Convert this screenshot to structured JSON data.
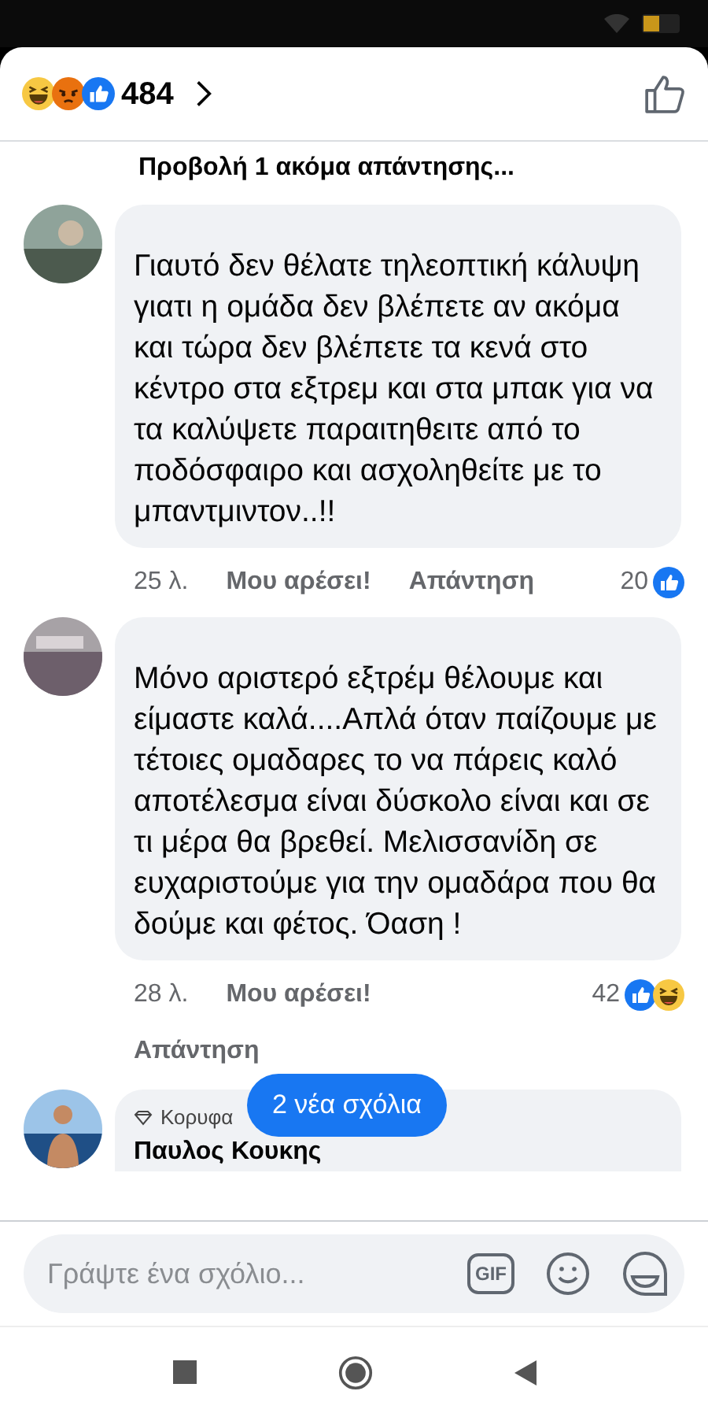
{
  "reactions_summary": {
    "kinds": [
      {
        "kind": "haha"
      },
      {
        "kind": "angry"
      },
      {
        "kind": "like"
      }
    ],
    "count": "484"
  },
  "view_more_replies": "Προβολή 1 ακόμα απάντησης...",
  "comments": [
    {
      "text": "Γιαυτό δεν θέλατε τηλεοπτική κάλυψη γιατι η ομάδα δεν βλέπετε αν ακόμα και τώρα δεν βλέπετε τα κενά στο κέντρο στα εξτρεμ και στα μπακ για να τα καλύψετε παραιτηθειτε από το ποδόσφαιρο και ασχοληθείτε με το μπαντμιντον..!!",
      "time": "25 λ.",
      "like_label": "Μου αρέσει!",
      "reply_label": "Απάντηση",
      "reaction_count": "20",
      "reactions": [
        {
          "kind": "like"
        }
      ]
    },
    {
      "text": "Μόνο αριστερό εξτρέμ θέλουμε και είμαστε καλά....Απλά όταν παίζουμε με τέτοιες ομαδαρες το να πάρεις καλό αποτέλεσμα είναι δύσκολο είναι και σε τι μέρα θα βρεθεί. Μελισσανίδη σε ευχαριστούμε για την ομαδάρα που θα δούμε και φέτος. Όαση !",
      "time": "28 λ.",
      "like_label": "Μου αρέσει!",
      "reply_label": "Απάντηση",
      "reaction_count": "42",
      "reactions": [
        {
          "kind": "like"
        },
        {
          "kind": "haha"
        }
      ]
    }
  ],
  "partial_comment": {
    "badge": "Κορυφα",
    "author": "Παυλος Κουκης"
  },
  "new_comments_button": "2 νέα σχόλια",
  "composer": {
    "placeholder": "Γράψτε ένα σχόλιο...",
    "gif_label": "GIF"
  }
}
